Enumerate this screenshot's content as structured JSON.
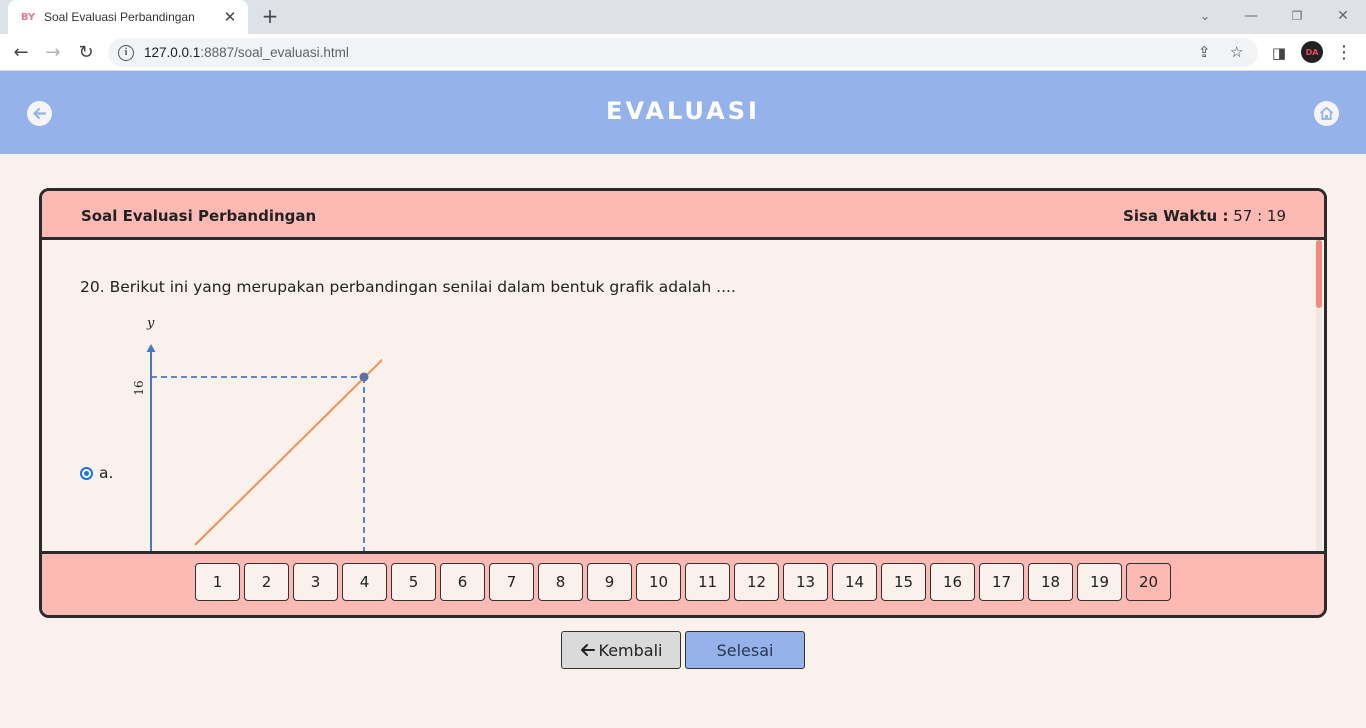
{
  "browser": {
    "tab_favicon": "BY",
    "tab_title": "Soal Evaluasi Perbandingan",
    "url_host": "127.0.0.1",
    "url_path": ":8887/soal_evaluasi.html",
    "profile_initials": "DA"
  },
  "header": {
    "title": "EVALUASI"
  },
  "quiz": {
    "title": "Soal Evaluasi Perbandingan",
    "timer_label": "Sisa Waktu :",
    "timer_value": "57 : 19",
    "question": "20. Berikut ini yang merupakan perbandingan senilai dalam bentuk grafik adalah ....",
    "option_a_label": "a.",
    "graph": {
      "y_axis_label": "y",
      "y_tick": "16"
    },
    "pages": [
      "1",
      "2",
      "3",
      "4",
      "5",
      "6",
      "7",
      "8",
      "9",
      "10",
      "11",
      "12",
      "13",
      "14",
      "15",
      "16",
      "17",
      "18",
      "19",
      "20"
    ],
    "current_page": "20"
  },
  "buttons": {
    "back_label": "Kembali",
    "finish_label": "Selesai"
  }
}
